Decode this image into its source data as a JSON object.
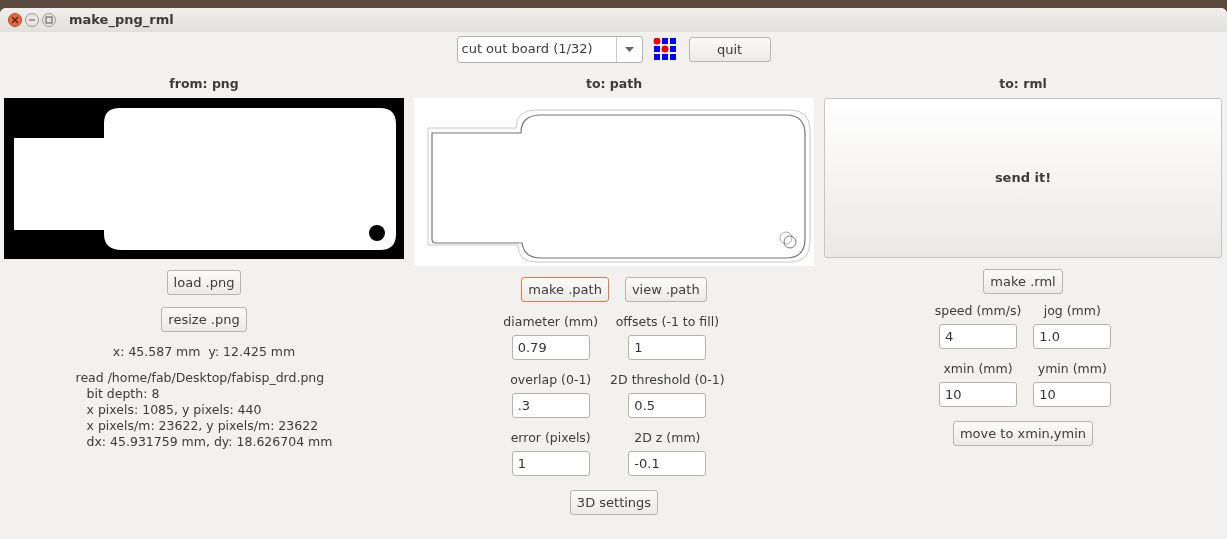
{
  "window": {
    "title": "make_png_rml"
  },
  "toolbar": {
    "mode_select": {
      "value": "cut out board (1/32)"
    },
    "quit_button": "quit"
  },
  "from_png": {
    "heading": "from: png",
    "buttons": [
      "load .png",
      "resize .png"
    ],
    "coordinates": "x: 45.587 mm  y: 12.425 mm",
    "info": {
      "title": "read /home/fab/Desktop/fabisp_drd.png",
      "details": [
        "bit depth: 8",
        "x pixels: 1085, y pixels: 440",
        "x pixels/m: 23622, y pixels/m: 23622",
        "dx: 45.931759 mm, dy: 18.626704 mm"
      ]
    }
  },
  "to_path": {
    "heading": "to: path",
    "buttons": [
      {
        "label": "make .path",
        "focused": true
      },
      {
        "label": "view .path",
        "focused": false
      }
    ],
    "fields": [
      {
        "label": "diameter (mm)",
        "value": "0.79"
      },
      {
        "label": "offsets (-1 to fill)",
        "value": "1"
      },
      {
        "label": "overlap (0-1)",
        "value": ".3"
      },
      {
        "label": "2D threshold (0-1)",
        "value": "0.5"
      },
      {
        "label": "error (pixels)",
        "value": "1"
      },
      {
        "label": "2D z (mm)",
        "value": "-0.1"
      }
    ],
    "settings_button": "3D settings"
  },
  "to_rml": {
    "heading": "to: rml",
    "send_button": "send it!",
    "make_button": "make .rml",
    "fields": [
      {
        "label": "speed (mm/s)",
        "value": "4"
      },
      {
        "label": "jog (mm)",
        "value": "1.0"
      },
      {
        "label": "xmin (mm)",
        "value": "10"
      },
      {
        "label": "ymin (mm)",
        "value": "10"
      }
    ],
    "move_button": "move to xmin,ymin"
  }
}
